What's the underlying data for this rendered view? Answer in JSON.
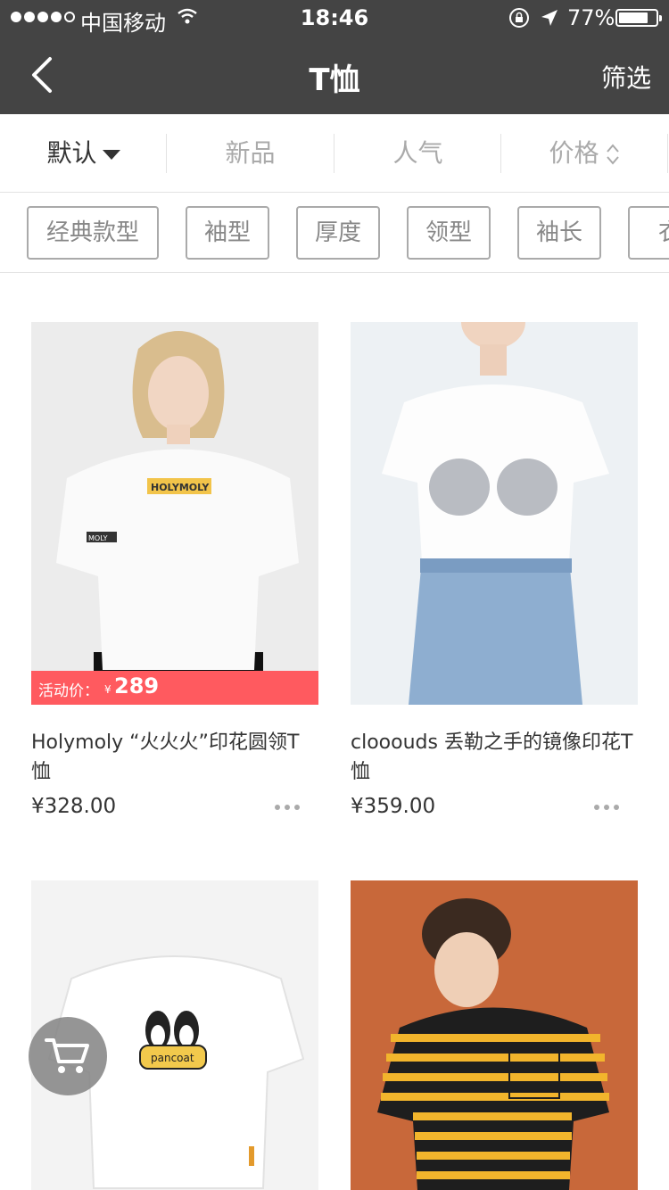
{
  "status_bar": {
    "carrier": "中国移动",
    "time": "18:46",
    "battery": "77%",
    "icons": [
      "signal-dots",
      "wifi-icon",
      "rotation-lock-icon",
      "location-arrow-icon",
      "battery-icon"
    ]
  },
  "nav": {
    "title": "T恤",
    "filter_label": "筛选",
    "back_icon": "chevron-left-icon"
  },
  "sort_tabs": [
    {
      "label": "默认",
      "active": true,
      "icon": "caret-down-icon"
    },
    {
      "label": "新品",
      "active": false
    },
    {
      "label": "人气",
      "active": false
    },
    {
      "label": "价格",
      "active": false,
      "icon": "sort-updown-icon"
    }
  ],
  "chips": [
    "经典款型",
    "袖型",
    "厚度",
    "领型",
    "袖长",
    "衣"
  ],
  "products": [
    {
      "name": "Holymoly “火火火”印花圆领T恤",
      "price": "¥328.00",
      "promo": {
        "label": "活动价：",
        "currency": "¥",
        "price": "289"
      },
      "image_print": "HOLYMOLY",
      "sleeve_print": "MOLY"
    },
    {
      "name": "clooouds 丢勒之手的镜像印花T恤",
      "price": "¥359.00"
    },
    {
      "name": "",
      "price": "",
      "image_print": "pancoat"
    },
    {
      "name": "",
      "price": ""
    }
  ],
  "colors": {
    "nav_bg": "#444444",
    "promo_bg": "#ff5a5f",
    "inactive_text": "#aaaaaa",
    "active_text": "#333333"
  },
  "fab": {
    "icon": "shopping-cart-icon"
  }
}
